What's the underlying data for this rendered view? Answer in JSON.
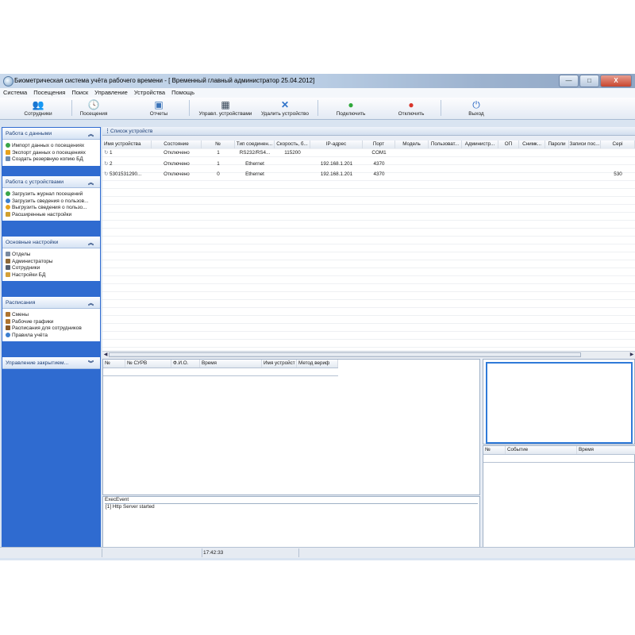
{
  "window": {
    "title": "Биометрическая система учёта рабочего времени - [ Временный главный администратор 25.04.2012]",
    "minimize": "—",
    "maximize": "□",
    "close": "X"
  },
  "menu": [
    "Система",
    "Посещения",
    "Поиск",
    "Управление",
    "Устройства",
    "Помощь"
  ],
  "toolbar": {
    "employees": "Сотрудники",
    "visits": "Посещения",
    "reports": "Отчеты",
    "manage_devices": "Управл. устройствами",
    "delete_device": "Удалить устройство",
    "connect": "Подключить",
    "disconnect": "Отключить",
    "exit": "Выход"
  },
  "sidebar": {
    "data": {
      "title": "Работа с данными",
      "items": [
        "Импорт данных о посещениях",
        "Экспорт данных о посещениях",
        "Создать резервную копию БД"
      ]
    },
    "devices": {
      "title": "Работа с устройствами",
      "items": [
        "Загрузить журнал посещений",
        "Загрузить сведения о пользов...",
        "Выгрузить сведения о пользо...",
        "Расширенные настройки"
      ]
    },
    "settings": {
      "title": "Основные настройки",
      "items": [
        "Отделы",
        "Администраторы",
        "Сотрудники",
        "Настройки БД"
      ]
    },
    "schedules": {
      "title": "Расписания",
      "items": [
        "Смены",
        "Рабочие графики",
        "Расписания для сотрудников",
        "Правила учёта"
      ]
    },
    "closing": {
      "title": "Управление закрытием..."
    }
  },
  "device_list": {
    "title": "Список устройств",
    "columns": [
      "Имя устройства",
      "Состояние",
      "№",
      "Тип соединен...",
      "Скорость, б...",
      "IP-адрес",
      "Порт",
      "Модель",
      "Пользоват...",
      "Администр...",
      "ОП",
      "Снимк...",
      "Пароли",
      "Записи пос...",
      "Сері"
    ],
    "rows": [
      [
        "1",
        "Отключено",
        "1",
        "RS232/RS4...",
        "115200",
        "",
        "COM1",
        "",
        "",
        "",
        "",
        "",
        "",
        "",
        ""
      ],
      [
        "2",
        "Отключено",
        "1",
        "Ethernet",
        "",
        "192.168.1.201",
        "4370",
        "",
        "",
        "",
        "",
        "",
        "",
        "",
        ""
      ],
      [
        "5301531290...",
        "Отключено",
        "0",
        "Ethernet",
        "",
        "192.168.1.201",
        "4370",
        "",
        "",
        "",
        "",
        "",
        "",
        "",
        "530"
      ]
    ]
  },
  "attendance_columns": [
    "№",
    "№ СУРВ",
    "Ф.И.О.",
    "Время",
    "Имя устройст",
    "Метод вериф"
  ],
  "events_columns": [
    "№",
    "Событие",
    "Время"
  ],
  "exec_event": {
    "title": "ExecEvent",
    "lines": [
      "[1] Http Server started"
    ]
  },
  "status": {
    "time": "17:42:33"
  }
}
